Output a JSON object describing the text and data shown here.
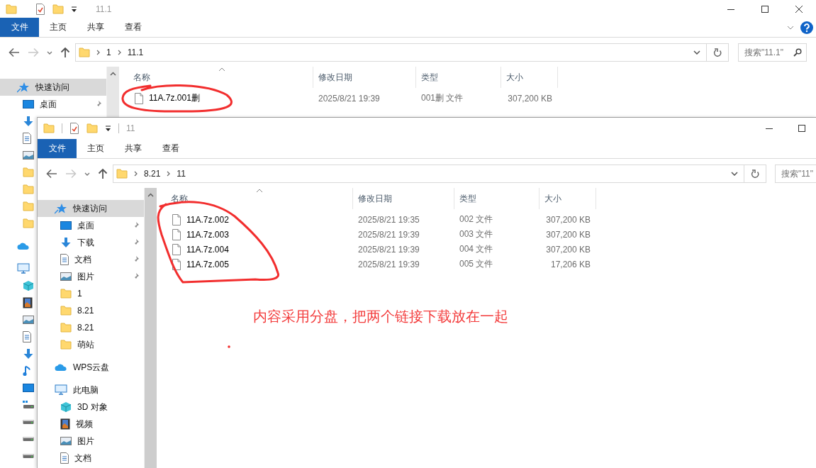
{
  "back_window": {
    "title": "11.1",
    "window_buttons": [
      {
        "kind": "minimize"
      },
      {
        "kind": "maximize"
      },
      {
        "kind": "close"
      }
    ],
    "help_button": true,
    "ribbon_tabs": [
      {
        "label": "文件",
        "selected": true
      },
      {
        "label": "主页",
        "selected": false
      },
      {
        "label": "共享",
        "selected": false
      },
      {
        "label": "查看",
        "selected": false
      }
    ],
    "address_path": [
      "1",
      "11.1"
    ],
    "search": {
      "placeholder": "搜索\"11.1\""
    },
    "nav": [
      {
        "kind": "quick",
        "label": "快速访问",
        "selected": true,
        "children": [
          {
            "kind": "desktop",
            "label": "桌面",
            "pinned": true,
            "selected": false
          },
          {
            "kind": "download",
            "pinned": false,
            "selected": false
          },
          {
            "kind": "document",
            "pinned": false,
            "selected": false
          },
          {
            "kind": "picture",
            "pinned": false,
            "selected": false
          },
          {
            "kind": "folder",
            "pinned": false,
            "selected": false
          },
          {
            "kind": "folder",
            "pinned": false,
            "selected": false
          },
          {
            "kind": "folder",
            "pinned": false,
            "selected": false
          },
          {
            "kind": "folder",
            "pinned": false,
            "selected": false
          }
        ]
      },
      {
        "kind": "cloud",
        "selected": false
      },
      {
        "kind": "pc",
        "selected": false,
        "children": [
          {
            "kind": "cube",
            "selected": false
          },
          {
            "kind": "film",
            "selected": false
          },
          {
            "kind": "picture",
            "selected": false
          },
          {
            "kind": "document",
            "selected": false
          },
          {
            "kind": "download",
            "selected": false
          },
          {
            "kind": "music",
            "selected": false
          },
          {
            "kind": "desktop",
            "selected": false
          },
          {
            "kind": "netdrive",
            "selected": false
          },
          {
            "kind": "drive",
            "selected": false
          },
          {
            "kind": "drive",
            "selected": false
          },
          {
            "kind": "drive",
            "selected": false
          }
        ]
      }
    ],
    "columns": [
      "名称",
      "修改日期",
      "类型",
      "大小"
    ],
    "files": [
      {
        "name": "11A.7z.001删",
        "modified": "2025/8/21 19:39",
        "type": "001删 文件",
        "size": "307,200 KB"
      }
    ]
  },
  "front_window": {
    "title": "11",
    "window_buttons": [
      {
        "kind": "minimize"
      },
      {
        "kind": "maximize"
      }
    ],
    "help_button": false,
    "ribbon_tabs": [
      {
        "label": "文件",
        "selected": true
      },
      {
        "label": "主页",
        "selected": false
      },
      {
        "label": "共享",
        "selected": false
      },
      {
        "label": "查看",
        "selected": false
      }
    ],
    "address_path": [
      "8.21",
      "11"
    ],
    "search": {
      "placeholder": "搜索\"11\""
    },
    "nav": [
      {
        "kind": "quick",
        "label": "快速访问",
        "selected": true,
        "children": [
          {
            "kind": "desktop",
            "label": "桌面",
            "pinned": true,
            "selected": false
          },
          {
            "kind": "download",
            "label": "下载",
            "pinned": true,
            "selected": false
          },
          {
            "kind": "document",
            "label": "文档",
            "pinned": true,
            "selected": false
          },
          {
            "kind": "picture",
            "label": "图片",
            "pinned": true,
            "selected": false
          },
          {
            "kind": "folder",
            "label": "1",
            "pinned": false,
            "selected": false
          },
          {
            "kind": "folder",
            "label": "8.21",
            "pinned": false,
            "selected": false
          },
          {
            "kind": "folder",
            "label": "8.21",
            "pinned": false,
            "selected": false
          },
          {
            "kind": "folder",
            "label": "萌站",
            "pinned": false,
            "selected": false
          }
        ]
      },
      {
        "kind": "cloud",
        "label": "WPS云盘",
        "selected": false
      },
      {
        "kind": "pc",
        "label": "此电脑",
        "selected": false,
        "children": [
          {
            "kind": "cube",
            "label": "3D 对象",
            "selected": false
          },
          {
            "kind": "film",
            "label": "视频",
            "selected": false
          },
          {
            "kind": "picture",
            "label": "图片",
            "selected": false
          },
          {
            "kind": "document",
            "label": "文档",
            "selected": false
          }
        ]
      }
    ],
    "columns": [
      "名称",
      "修改日期",
      "类型",
      "大小"
    ],
    "files": [
      {
        "name": "11A.7z.002",
        "modified": "2025/8/21 19:35",
        "type": "002 文件",
        "size": "307,200 KB"
      },
      {
        "name": "11A.7z.003",
        "modified": "2025/8/21 19:39",
        "type": "003 文件",
        "size": "307,200 KB"
      },
      {
        "name": "11A.7z.004",
        "modified": "2025/8/21 19:39",
        "type": "004 文件",
        "size": "307,200 KB"
      },
      {
        "name": "11A.7z.005",
        "modified": "2025/8/21 19:39",
        "type": "005 文件",
        "size": "17,206 KB"
      }
    ]
  },
  "annotation_note": "内容采用分盘，把两个链接下载放在一起"
}
